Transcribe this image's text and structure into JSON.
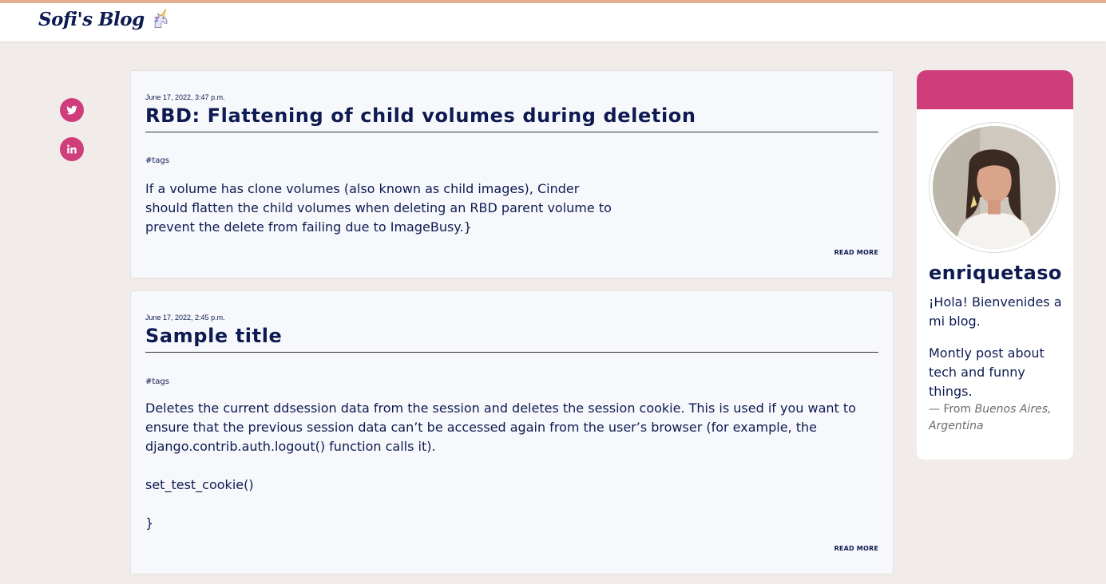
{
  "header": {
    "brand": "Sofi's Blog",
    "brand_emoji": "unicorn-icon"
  },
  "social": [
    {
      "name": "twitter",
      "icon": "twitter-icon"
    },
    {
      "name": "linkedin",
      "icon": "linkedin-icon"
    }
  ],
  "posts": [
    {
      "date": "June 17, 2022, 3:47 p.m.",
      "title": "RBD: Flattening of child volumes during deletion",
      "tags": "#tags",
      "body": [
        "If a volume has clone volumes (also known as child images), Cinder",
        "should flatten the child volumes when deleting an RBD parent volume to",
        "prevent the delete from failing due to ImageBusy.}"
      ],
      "read_more": "READ MORE"
    },
    {
      "date": "June 17, 2022, 2:45 p.m.",
      "title": "Sample title",
      "tags": "#tags",
      "body": [
        "Deletes the current ddsession data from the session and deletes the session cookie. This is used if you want to",
        "ensure that the previous session data can’t be accessed again from the user’s browser (for example, the",
        "django.contrib.auth.logout() function calls it).",
        "",
        "set_test_cookie()",
        "",
        "}"
      ],
      "read_more": "READ MORE"
    }
  ],
  "profile": {
    "username": "enriquetaso",
    "greeting": "¡Hola! Bienvenides a mi blog.",
    "description": "Montly post about tech and funny things.",
    "location_prefix": "— From",
    "location": "Buenos Aires, Argentina"
  },
  "colors": {
    "accent": "#cf3e7b",
    "text": "#0e1b52",
    "background": "#f1ecea",
    "topbar_border": "#e2b08c"
  }
}
